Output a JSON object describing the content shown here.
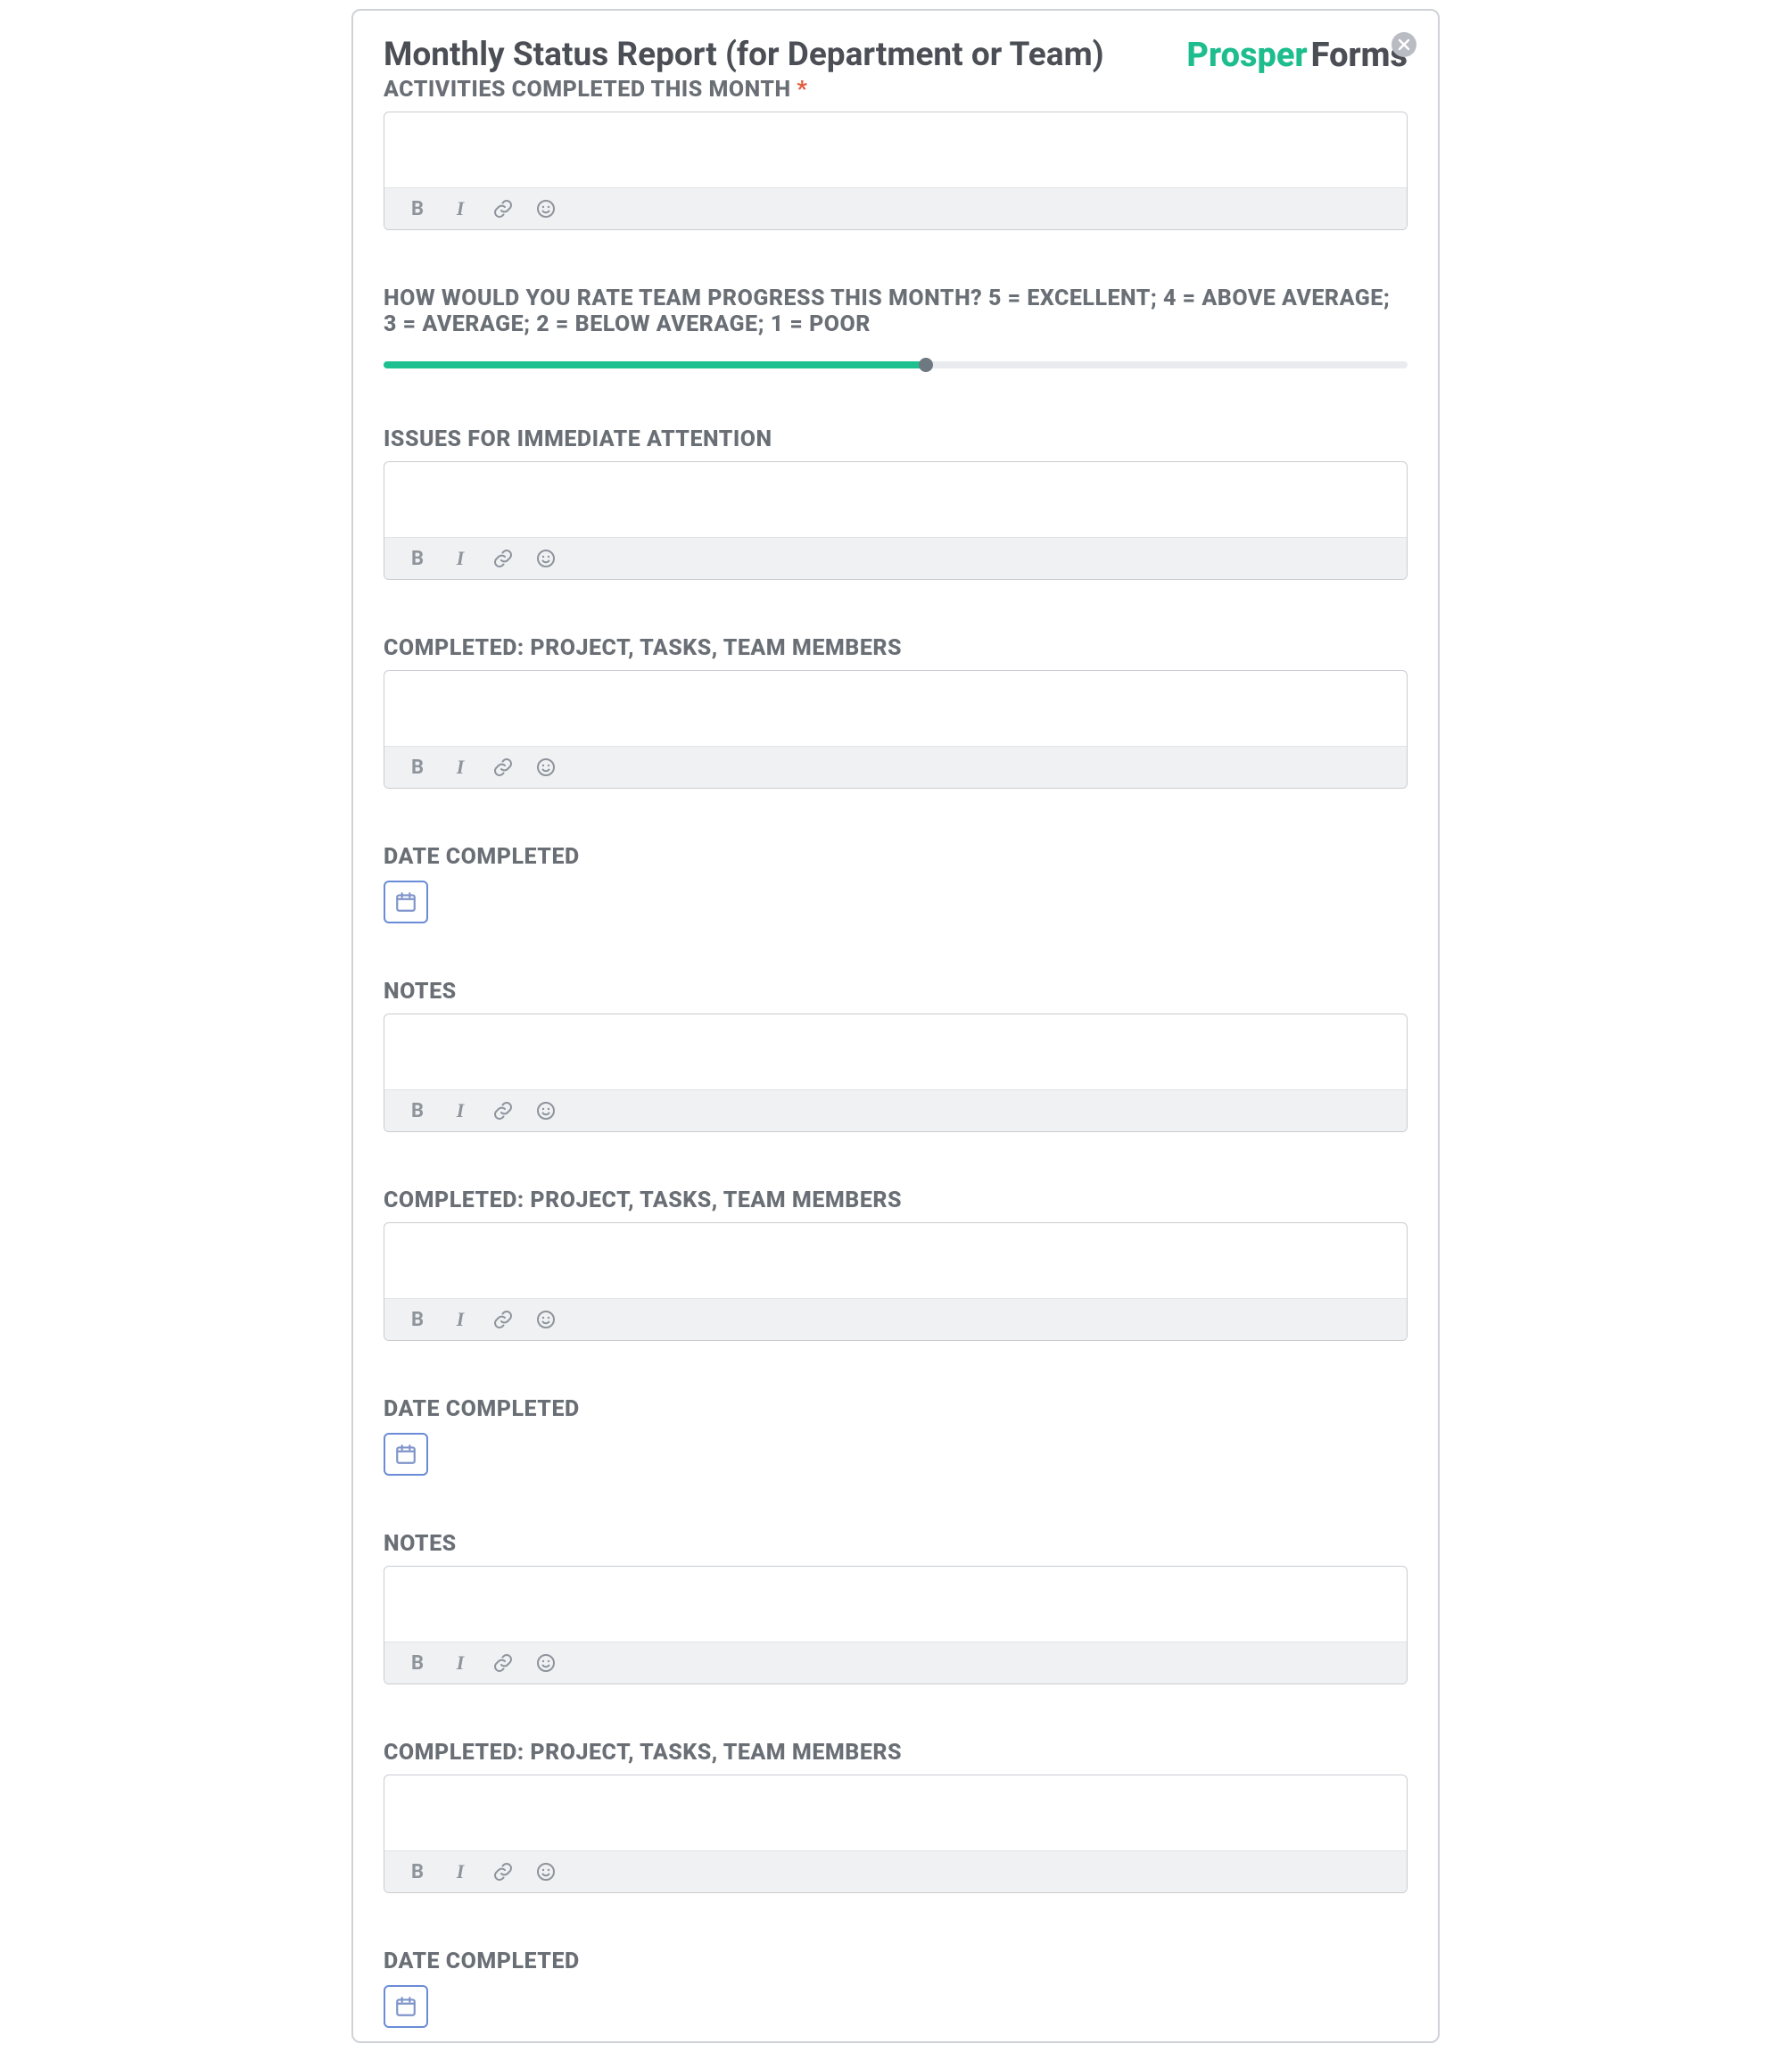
{
  "logo": {
    "part1": "Prosper",
    "part2": "Forms"
  },
  "title": "Monthly Status Report (for Department or Team)",
  "required_marker": "*",
  "slider": {
    "percent": 53
  },
  "fields": {
    "activities": {
      "label": "ACTIVITIES COMPLETED THIS MONTH",
      "required": true
    },
    "rating": {
      "label": "HOW WOULD YOU RATE TEAM PROGRESS THIS MONTH? 5 = EXCELLENT; 4 = ABOVE AVERAGE; 3 = AVERAGE; 2 = BELOW AVERAGE; 1 = POOR"
    },
    "issues": {
      "label": "ISSUES FOR IMMEDIATE ATTENTION"
    },
    "completed1": {
      "label": "COMPLETED: PROJECT, TASKS, TEAM MEMBERS"
    },
    "date1": {
      "label": "DATE COMPLETED"
    },
    "notes1": {
      "label": "NOTES"
    },
    "completed2": {
      "label": "COMPLETED: PROJECT, TASKS, TEAM MEMBERS"
    },
    "date2": {
      "label": "DATE COMPLETED"
    },
    "notes2": {
      "label": "NOTES"
    },
    "completed3": {
      "label": "COMPLETED: PROJECT, TASKS, TEAM MEMBERS"
    },
    "date3": {
      "label": "DATE COMPLETED"
    }
  },
  "toolbar": {
    "bold": "B",
    "italic": "I"
  }
}
